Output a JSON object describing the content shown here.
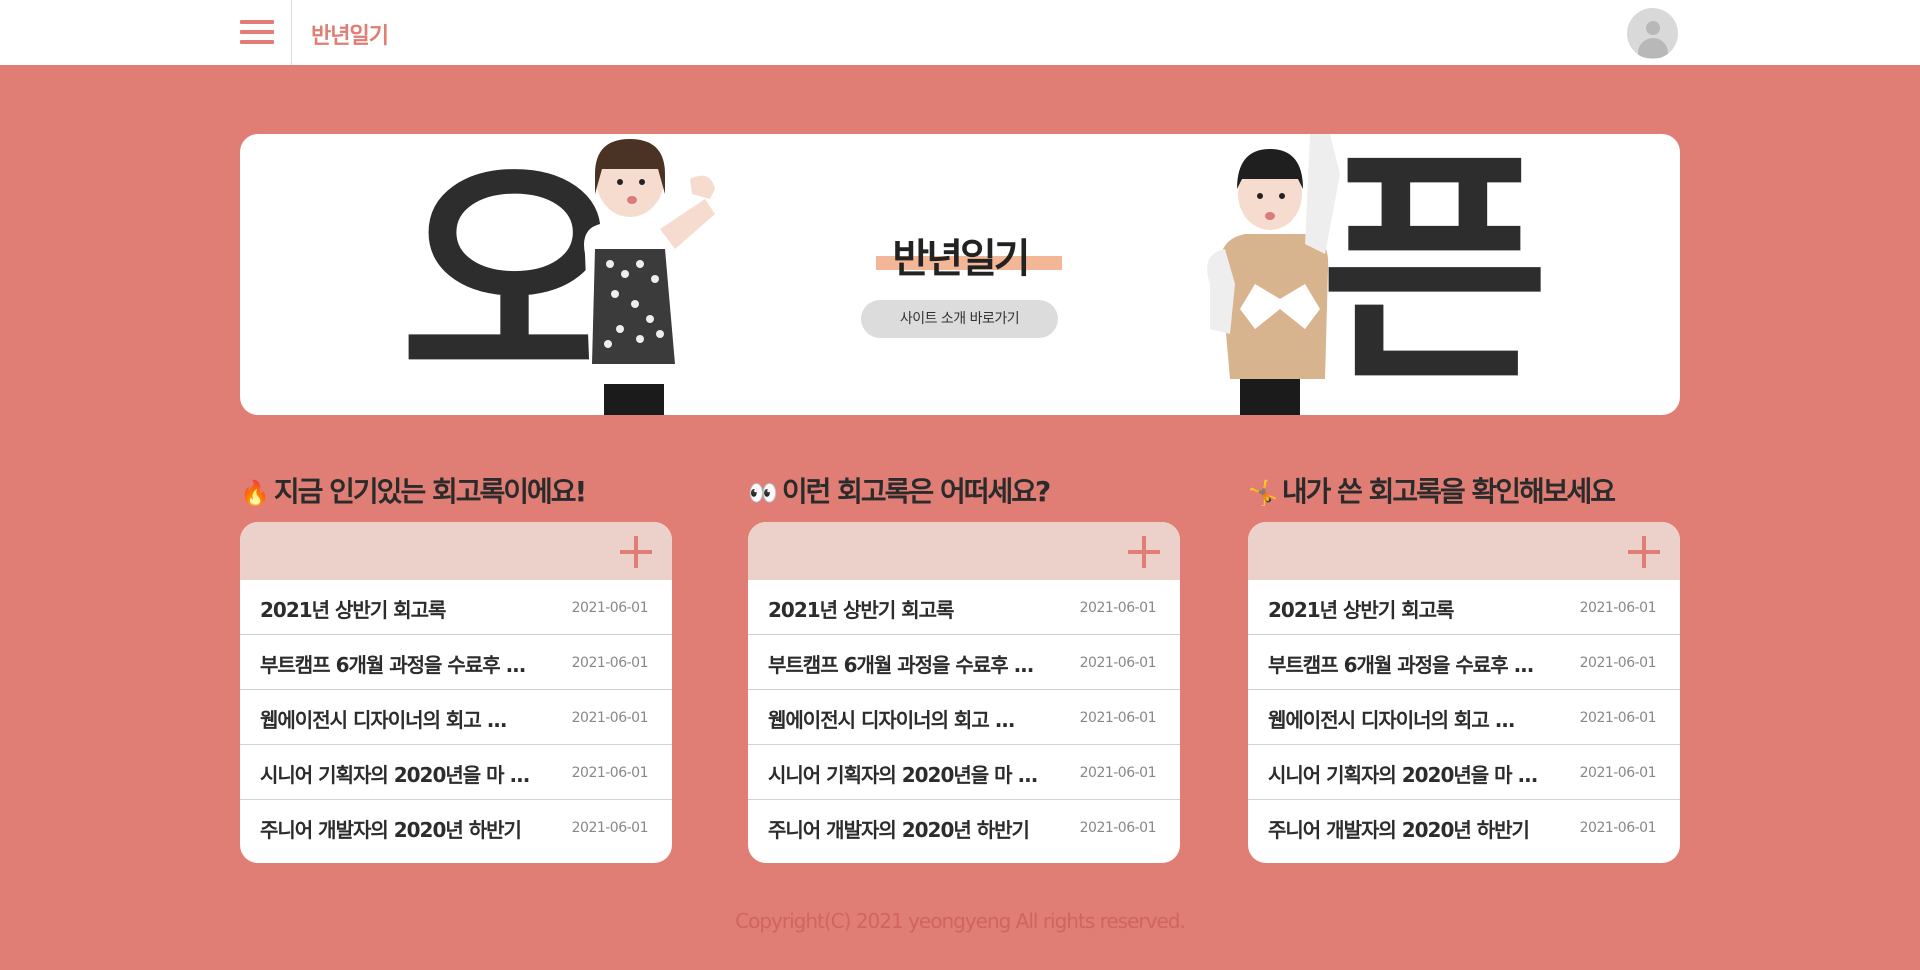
{
  "header": {
    "logo": "반년일기",
    "menu_icon": "hamburger-menu-icon",
    "avatar_icon": "user-avatar-icon"
  },
  "banner": {
    "left_letter": "오",
    "right_letter": "픈",
    "title": "반년일기",
    "button": "사이트 소개 바로가기"
  },
  "sections": [
    {
      "emoji": "🔥",
      "title": "지금 인기있는 회고록이에요!",
      "items": [
        {
          "title": "2021년 상반기 회고록",
          "date": "2021-06-01"
        },
        {
          "title": "부트캠프 6개월 과정을 수료후 ...",
          "date": "2021-06-01"
        },
        {
          "title": "웹에이전시 디자이너의 회고 ...",
          "date": "2021-06-01"
        },
        {
          "title": "시니어 기획자의 2020년을 마 ...",
          "date": "2021-06-01"
        },
        {
          "title": "주니어 개발자의 2020년 하반기",
          "date": "2021-06-01"
        }
      ]
    },
    {
      "emoji": "👀",
      "title": "이런 회고록은 어떠세요?",
      "items": [
        {
          "title": "2021년 상반기 회고록",
          "date": "2021-06-01"
        },
        {
          "title": "부트캠프 6개월 과정을 수료후 ...",
          "date": "2021-06-01"
        },
        {
          "title": "웹에이전시 디자이너의 회고 ...",
          "date": "2021-06-01"
        },
        {
          "title": "시니어 기획자의 2020년을 마 ...",
          "date": "2021-06-01"
        },
        {
          "title": "주니어 개발자의 2020년 하반기",
          "date": "2021-06-01"
        }
      ]
    },
    {
      "emoji": "🤸",
      "title": "내가 쓴 회고록을 확인해보세요",
      "items": [
        {
          "title": "2021년 상반기 회고록",
          "date": "2021-06-01"
        },
        {
          "title": "부트캠프 6개월 과정을 수료후 ...",
          "date": "2021-06-01"
        },
        {
          "title": "웹에이전시 디자이너의 회고 ...",
          "date": "2021-06-01"
        },
        {
          "title": "시니어 기획자의 2020년을 마 ...",
          "date": "2021-06-01"
        },
        {
          "title": "주니어 개발자의 2020년 하반기",
          "date": "2021-06-01"
        }
      ]
    }
  ],
  "footer": "Copyright(C) 2021 yeongyeng All rights reserved.",
  "colors": {
    "background": "#e07e75",
    "card_header": "#ebd1c9",
    "highlight": "#f3b797",
    "text_dark": "#2d2d2d"
  }
}
